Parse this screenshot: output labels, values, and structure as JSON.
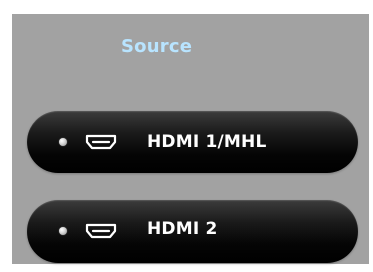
{
  "screen": {
    "title": "Source"
  },
  "sources": [
    {
      "label": "HDMI 1/MHL",
      "icon": "hdmi-icon"
    },
    {
      "label": "HDMI 2",
      "icon": "hdmi-icon"
    }
  ],
  "colors": {
    "background": "#a2a2a2",
    "title": "#b8e4ff",
    "button": "#050505",
    "text": "#ffffff"
  }
}
